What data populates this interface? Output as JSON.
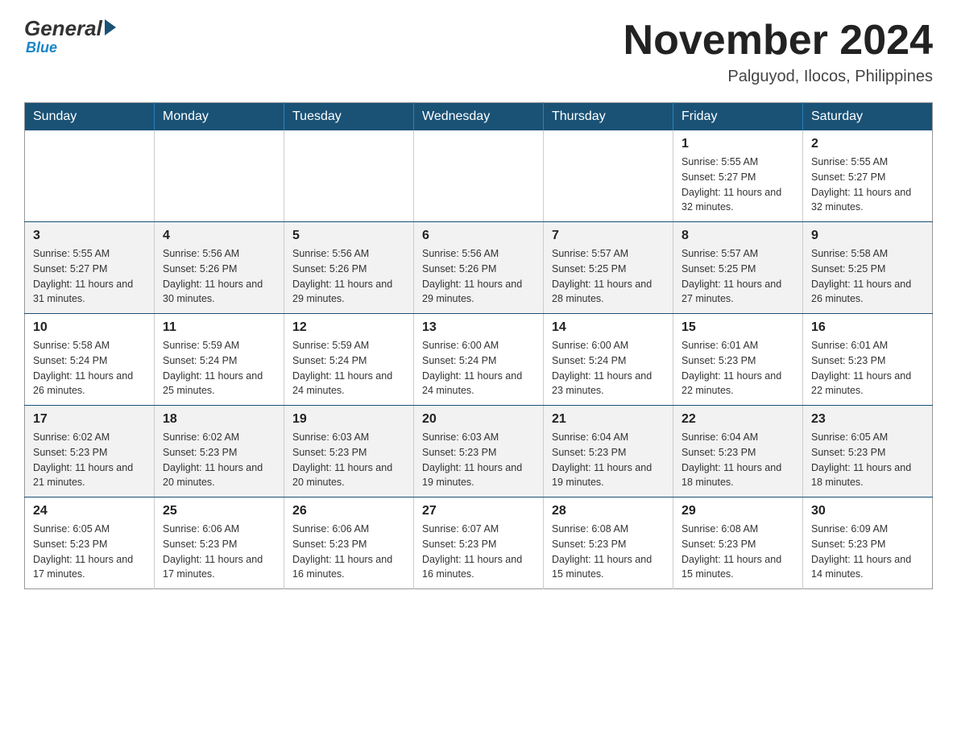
{
  "header": {
    "logo": {
      "general_text": "General",
      "blue_text": "Blue"
    },
    "title": "November 2024",
    "location": "Palguyod, Ilocos, Philippines"
  },
  "days_of_week": [
    "Sunday",
    "Monday",
    "Tuesday",
    "Wednesday",
    "Thursday",
    "Friday",
    "Saturday"
  ],
  "weeks": [
    [
      {
        "day": "",
        "info": ""
      },
      {
        "day": "",
        "info": ""
      },
      {
        "day": "",
        "info": ""
      },
      {
        "day": "",
        "info": ""
      },
      {
        "day": "",
        "info": ""
      },
      {
        "day": "1",
        "info": "Sunrise: 5:55 AM\nSunset: 5:27 PM\nDaylight: 11 hours and 32 minutes."
      },
      {
        "day": "2",
        "info": "Sunrise: 5:55 AM\nSunset: 5:27 PM\nDaylight: 11 hours and 32 minutes."
      }
    ],
    [
      {
        "day": "3",
        "info": "Sunrise: 5:55 AM\nSunset: 5:27 PM\nDaylight: 11 hours and 31 minutes."
      },
      {
        "day": "4",
        "info": "Sunrise: 5:56 AM\nSunset: 5:26 PM\nDaylight: 11 hours and 30 minutes."
      },
      {
        "day": "5",
        "info": "Sunrise: 5:56 AM\nSunset: 5:26 PM\nDaylight: 11 hours and 29 minutes."
      },
      {
        "day": "6",
        "info": "Sunrise: 5:56 AM\nSunset: 5:26 PM\nDaylight: 11 hours and 29 minutes."
      },
      {
        "day": "7",
        "info": "Sunrise: 5:57 AM\nSunset: 5:25 PM\nDaylight: 11 hours and 28 minutes."
      },
      {
        "day": "8",
        "info": "Sunrise: 5:57 AM\nSunset: 5:25 PM\nDaylight: 11 hours and 27 minutes."
      },
      {
        "day": "9",
        "info": "Sunrise: 5:58 AM\nSunset: 5:25 PM\nDaylight: 11 hours and 26 minutes."
      }
    ],
    [
      {
        "day": "10",
        "info": "Sunrise: 5:58 AM\nSunset: 5:24 PM\nDaylight: 11 hours and 26 minutes."
      },
      {
        "day": "11",
        "info": "Sunrise: 5:59 AM\nSunset: 5:24 PM\nDaylight: 11 hours and 25 minutes."
      },
      {
        "day": "12",
        "info": "Sunrise: 5:59 AM\nSunset: 5:24 PM\nDaylight: 11 hours and 24 minutes."
      },
      {
        "day": "13",
        "info": "Sunrise: 6:00 AM\nSunset: 5:24 PM\nDaylight: 11 hours and 24 minutes."
      },
      {
        "day": "14",
        "info": "Sunrise: 6:00 AM\nSunset: 5:24 PM\nDaylight: 11 hours and 23 minutes."
      },
      {
        "day": "15",
        "info": "Sunrise: 6:01 AM\nSunset: 5:23 PM\nDaylight: 11 hours and 22 minutes."
      },
      {
        "day": "16",
        "info": "Sunrise: 6:01 AM\nSunset: 5:23 PM\nDaylight: 11 hours and 22 minutes."
      }
    ],
    [
      {
        "day": "17",
        "info": "Sunrise: 6:02 AM\nSunset: 5:23 PM\nDaylight: 11 hours and 21 minutes."
      },
      {
        "day": "18",
        "info": "Sunrise: 6:02 AM\nSunset: 5:23 PM\nDaylight: 11 hours and 20 minutes."
      },
      {
        "day": "19",
        "info": "Sunrise: 6:03 AM\nSunset: 5:23 PM\nDaylight: 11 hours and 20 minutes."
      },
      {
        "day": "20",
        "info": "Sunrise: 6:03 AM\nSunset: 5:23 PM\nDaylight: 11 hours and 19 minutes."
      },
      {
        "day": "21",
        "info": "Sunrise: 6:04 AM\nSunset: 5:23 PM\nDaylight: 11 hours and 19 minutes."
      },
      {
        "day": "22",
        "info": "Sunrise: 6:04 AM\nSunset: 5:23 PM\nDaylight: 11 hours and 18 minutes."
      },
      {
        "day": "23",
        "info": "Sunrise: 6:05 AM\nSunset: 5:23 PM\nDaylight: 11 hours and 18 minutes."
      }
    ],
    [
      {
        "day": "24",
        "info": "Sunrise: 6:05 AM\nSunset: 5:23 PM\nDaylight: 11 hours and 17 minutes."
      },
      {
        "day": "25",
        "info": "Sunrise: 6:06 AM\nSunset: 5:23 PM\nDaylight: 11 hours and 17 minutes."
      },
      {
        "day": "26",
        "info": "Sunrise: 6:06 AM\nSunset: 5:23 PM\nDaylight: 11 hours and 16 minutes."
      },
      {
        "day": "27",
        "info": "Sunrise: 6:07 AM\nSunset: 5:23 PM\nDaylight: 11 hours and 16 minutes."
      },
      {
        "day": "28",
        "info": "Sunrise: 6:08 AM\nSunset: 5:23 PM\nDaylight: 11 hours and 15 minutes."
      },
      {
        "day": "29",
        "info": "Sunrise: 6:08 AM\nSunset: 5:23 PM\nDaylight: 11 hours and 15 minutes."
      },
      {
        "day": "30",
        "info": "Sunrise: 6:09 AM\nSunset: 5:23 PM\nDaylight: 11 hours and 14 minutes."
      }
    ]
  ]
}
